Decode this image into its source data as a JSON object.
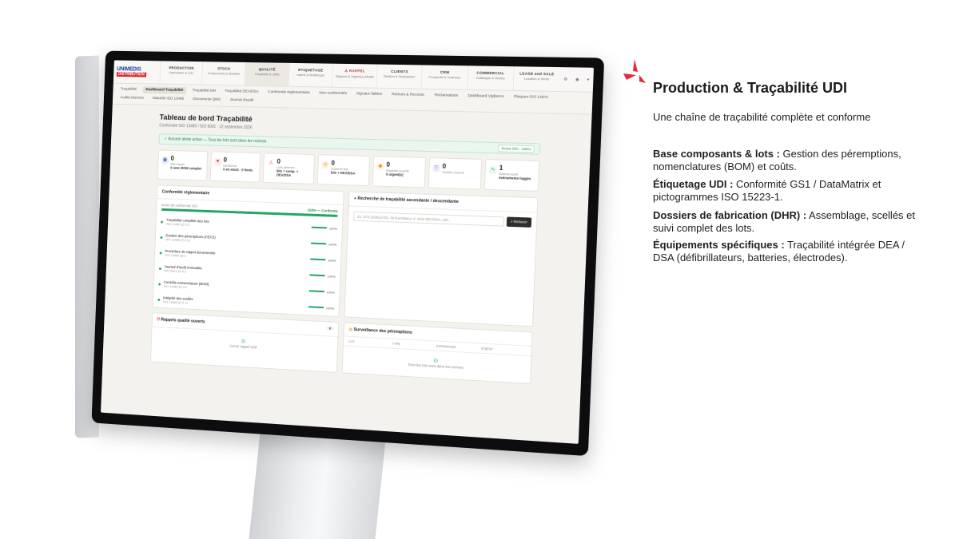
{
  "side": {
    "title": "Production & Traçabilité UDI",
    "intro": "Une chaîne de traçabilité complète et conforme",
    "features": [
      {
        "bold": "Base composants & lots :",
        "text": " Gestion des péremptions, nomenclatures (BOM) et coûts."
      },
      {
        "bold": "Étiquetage UDI :",
        "text": " Conformité GS1 / DataMatrix et pictogrammes ISO 15223-1."
      },
      {
        "bold": "Dossiers de fabrication (DHR) :",
        "text": " Assemblage, scellés et suivi complet des lots."
      },
      {
        "bold": "Équipements spécifiques :",
        "text": " Traçabilité intégrée DEA / DSA (défibrillateurs, batteries, électrodes)."
      }
    ]
  },
  "app": {
    "logo_top": "UNIMEDIS",
    "logo_bottom": "DISTRIBUTION",
    "modules": [
      {
        "title": "PRODUCTION",
        "sub": "Fabrication & Lots"
      },
      {
        "title": "STOCK",
        "sub": "Composants & Modèles"
      },
      {
        "title": "QUALITÉ",
        "sub": "Traçabilité & QMS"
      },
      {
        "title": "ÉTIQUETAGE",
        "sub": "Labels & Multilingue"
      },
      {
        "title": "⚠ RAPPEL",
        "sub": "Rappels & Vigilance ANSM"
      },
      {
        "title": "CLIENTS",
        "sub": "Gestion & Satisfaction"
      },
      {
        "title": "CRM",
        "sub": "Prospects & Tournées"
      },
      {
        "title": "COMMERCIAL",
        "sub": "Catalogue & Ventes"
      },
      {
        "title": "LEASE and SALE",
        "sub": "Location & Vente"
      }
    ],
    "subnav": [
      "Traçabilité",
      "Dashboard Traçabilité",
      "Traçabilité DM",
      "Traçabilité DEA/DSA",
      "Conformité réglementaire",
      "Non-conformités",
      "Signaux faibles",
      "Retours & Reconsi.",
      "Réclamations",
      "Dashboard Vigilance",
      "Risques ISO 14971",
      "Audits internes",
      "Maturité ISO 13485",
      "Documents QMS",
      "Journal d'audit"
    ],
    "dash_title": "Tableau de bord Traçabilité",
    "dash_sub": "Conformité ISO 13485 / ISO 9001 · 12 septembre 2026",
    "alert_text": "Aucune alerte active — Tous les lots sont dans les normes",
    "alert_badge": "Score ISO : 100%",
    "stats": [
      {
        "val": "0",
        "lbl": "Kits tracés",
        "det": "0 avec BOM complet",
        "color": "#e8eefb",
        "fg": "#3a62c9",
        "icon": "▣"
      },
      {
        "val": "0",
        "lbl": "DEA/DSA",
        "det": "0 en stock · 0 livrés",
        "color": "#fdeaea",
        "fg": "#d2232a",
        "icon": "♥"
      },
      {
        "val": "0",
        "lbl": "Lots périmés",
        "det": "kits + comp. + DEA/DSA",
        "color": "#fff",
        "fg": "#d2232a",
        "icon": "⚠"
      },
      {
        "val": "0",
        "lbl": "Expirent 60j",
        "det": "kits + DEA/DSA",
        "color": "#fff4e3",
        "fg": "#e08a12",
        "icon": "◷"
      },
      {
        "val": "0",
        "lbl": "Rappels ouverts",
        "det": "0 urgent(s)",
        "color": "#fff4e3",
        "fg": "#e08a12",
        "icon": "◉"
      },
      {
        "val": "0",
        "lbl": "Scellés ouverts",
        "det": "",
        "color": "#f1ecfb",
        "fg": "#7a55c9",
        "icon": "▽"
      },
      {
        "val": "1",
        "lbl": "Actions audit",
        "det": "évènements loggés",
        "color": "#eaf7ef",
        "fg": "#22a565",
        "icon": "∿"
      }
    ],
    "conf_title": "Conformité réglementaire",
    "score_label": "Score de conformité ISO",
    "score_value": "100% — Conforme",
    "score": 1.0,
    "criteria": [
      {
        "name": "Traçabilité complète des lots",
        "ref": "ISO 13485 §7.5.9",
        "pct": "100%"
      },
      {
        "name": "Gestion des péremptions (FEFO)",
        "ref": "ISO 13485 §7.5.11",
        "pct": "100%"
      },
      {
        "name": "Procédure de rappel documentée",
        "ref": "ISO 13485 §8.3",
        "pct": "100%"
      },
      {
        "name": "Journal d'audit immuable",
        "ref": "ISO 9001 §7.5.3",
        "pct": "100%"
      },
      {
        "name": "Contrôle nomenclature (BOM)",
        "ref": "ISO 13485 §7.5.9",
        "pct": "100%"
      },
      {
        "name": "Intégrité des scellés",
        "ref": "ISO 13485 §7.5.11",
        "pct": "100%"
      }
    ],
    "search_title": "Recherche de traçabilité ascendante / descendante",
    "search_placeholder": "Ex: CFK-250812-001, lot fournisseur, n° série DEA/DSA, UDI...",
    "search_btn": "Retracer",
    "recalls_title": "Rappels qualité ouverts",
    "recalls_count": "0",
    "recalls_empty": "Aucun rappel actif",
    "expiry_title": "Surveillance des péremptions",
    "expiry_cols": [
      "LOT",
      "TYPE",
      "EXPIRATION",
      "STATUT"
    ],
    "expiry_empty": "Tous les lots sont dans les normes"
  }
}
